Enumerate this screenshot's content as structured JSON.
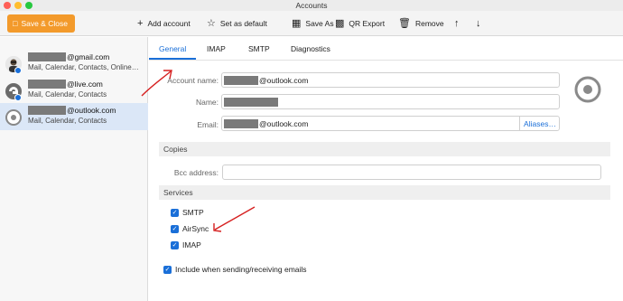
{
  "window": {
    "title": "Accounts"
  },
  "toolbar": {
    "save_close": "Save & Close",
    "add_account": "Add account",
    "set_default": "Set as default",
    "save_as": "Save As",
    "qr_export": "QR Export",
    "remove": "Remove"
  },
  "sidebar": {
    "accounts": [
      {
        "name": "@gmail.com",
        "services": "Mail, Calendar, Contacts, Online…"
      },
      {
        "name": "@live.com",
        "services": "Mail, Calendar, Contacts"
      },
      {
        "name": "@outlook.com",
        "services": "Mail, Calendar, Contacts"
      }
    ]
  },
  "tabs": [
    "General",
    "IMAP",
    "SMTP",
    "Diagnostics"
  ],
  "general": {
    "account_name_label": "Account name:",
    "account_name_value": "@outlook.com",
    "name_label": "Name:",
    "email_label": "Email:",
    "email_value": "@outlook.com",
    "aliases_button": "Aliases…",
    "copies_header": "Copies",
    "bcc_label": "Bcc address:",
    "services_header": "Services",
    "services": [
      "SMTP",
      "AirSync",
      "IMAP"
    ],
    "include_label": "Include when sending/receiving emails"
  },
  "colors": {
    "accent": "#1a6fd8",
    "save_button": "#f39a2b",
    "selected_row": "#dbe7f7",
    "annotation": "#d62020"
  }
}
